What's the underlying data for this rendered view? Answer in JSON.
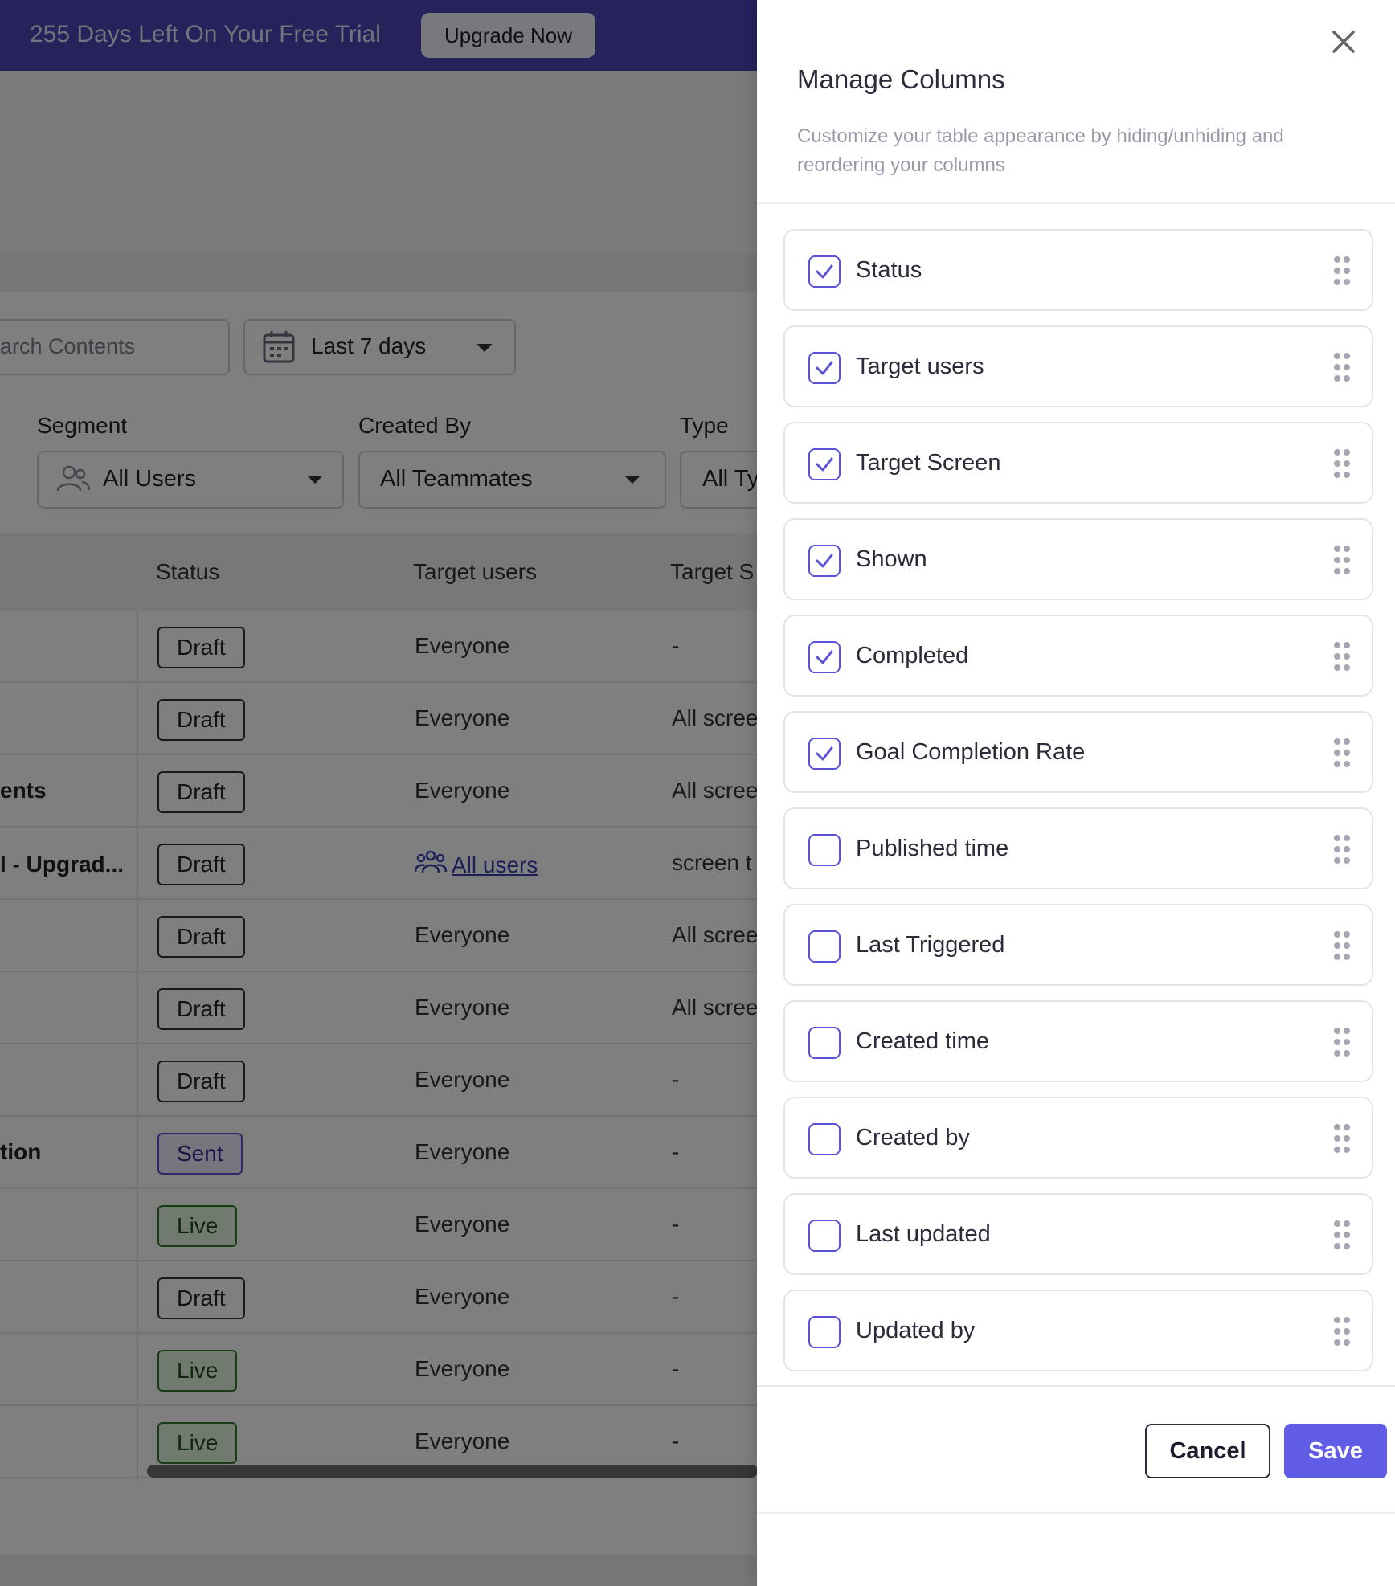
{
  "banner": {
    "trial_text": "255 Days Left On Your Free Trial",
    "upgrade_label": "Upgrade Now"
  },
  "toolbar": {
    "search_placeholder": "arch Contents",
    "date_range": "Last 7 days"
  },
  "filters": {
    "segment_label": "Segment",
    "segment_value": "All Users",
    "created_by_label": "Created By",
    "created_by_value": "All Teammates",
    "type_label": "Type",
    "type_value": "All Ty"
  },
  "table": {
    "headers": [
      "Status",
      "Target users",
      "Target S"
    ],
    "rows": [
      {
        "name": "",
        "status": "Draft",
        "target": "Everyone",
        "screen": "-"
      },
      {
        "name": "",
        "status": "Draft",
        "target": "Everyone",
        "screen": "All scree"
      },
      {
        "name": "ents",
        "status": "Draft",
        "target": "Everyone",
        "screen": "All scree"
      },
      {
        "name": "l - Upgrad...",
        "status": "Draft",
        "target": "All users",
        "screen": "screen t"
      },
      {
        "name": "",
        "status": "Draft",
        "target": "Everyone",
        "screen": "All scree"
      },
      {
        "name": "",
        "status": "Draft",
        "target": "Everyone",
        "screen": "All scree"
      },
      {
        "name": "",
        "status": "Draft",
        "target": "Everyone",
        "screen": "-"
      },
      {
        "name": "tion",
        "status": "Sent",
        "target": "Everyone",
        "screen": "-"
      },
      {
        "name": "",
        "status": "Live",
        "target": "Everyone",
        "screen": "-"
      },
      {
        "name": "",
        "status": "Draft",
        "target": "Everyone",
        "screen": "-"
      },
      {
        "name": "",
        "status": "Live",
        "target": "Everyone",
        "screen": "-"
      },
      {
        "name": "",
        "status": "Live",
        "target": "Everyone",
        "screen": "-"
      }
    ]
  },
  "drawer": {
    "title": "Manage Columns",
    "description": "Customize your table appearance by hiding/unhiding and reordering your columns",
    "columns": [
      {
        "label": "Status",
        "checked": true
      },
      {
        "label": "Target users",
        "checked": true
      },
      {
        "label": "Target Screen",
        "checked": true
      },
      {
        "label": "Shown",
        "checked": true
      },
      {
        "label": "Completed",
        "checked": true
      },
      {
        "label": "Goal Completion Rate",
        "checked": true
      },
      {
        "label": "Published time",
        "checked": false
      },
      {
        "label": "Last Triggered",
        "checked": false
      },
      {
        "label": "Created time",
        "checked": false
      },
      {
        "label": "Created by",
        "checked": false
      },
      {
        "label": "Last updated",
        "checked": false
      },
      {
        "label": "Updated by",
        "checked": false
      }
    ],
    "cancel_label": "Cancel",
    "save_label": "Save"
  },
  "colors": {
    "accent": "#615ce6",
    "banner": "#4b45b8"
  }
}
